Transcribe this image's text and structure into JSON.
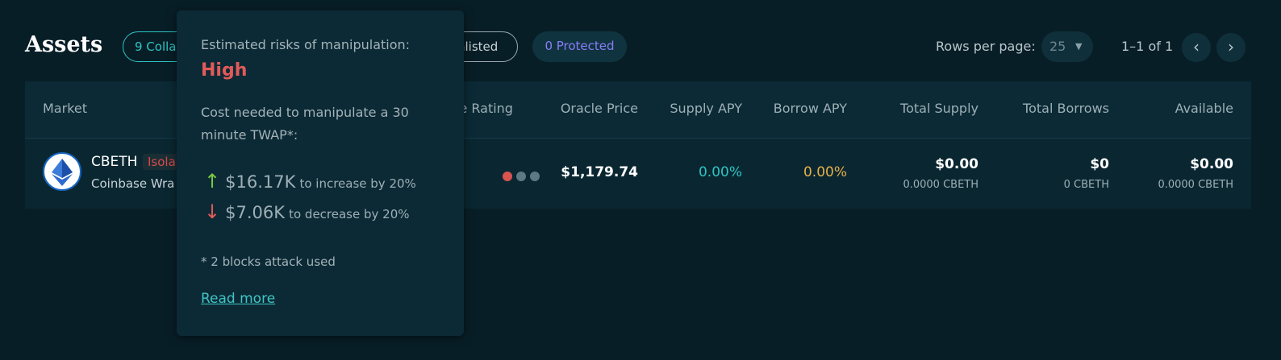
{
  "header": {
    "title": "Assets",
    "chips": {
      "collateral": "9 Collat",
      "unlisted": "nlisted",
      "protected": "0 Protected"
    },
    "rows_per_page_label": "Rows per page:",
    "rows_per_page_value": "25",
    "range": "1–1 of 1",
    "prev_icon": "‹",
    "next_icon": "›"
  },
  "table": {
    "columns": {
      "market": "Market",
      "oracle_rating": "le Rating",
      "oracle_price": "Oracle Price",
      "supply_apy": "Supply APY",
      "borrow_apy": "Borrow APY",
      "total_supply": "Total Supply",
      "total_borrows": "Total Borrows",
      "available": "Available"
    },
    "rows": [
      {
        "symbol": "CBETH",
        "badge": "Isola",
        "name": "Coinbase Wra",
        "rating_colors": [
          "#d9534f",
          "#5d7a84",
          "#5d7a84"
        ],
        "oracle_price": "$1,179.74",
        "supply_apy": "0.00%",
        "borrow_apy": "0.00%",
        "total_supply": "$0.00",
        "total_supply_sub": "0.0000 CBETH",
        "total_borrows": "$0",
        "total_borrows_sub": "0 CBETH",
        "available": "$0.00",
        "available_sub": "0.0000 CBETH"
      }
    ]
  },
  "tooltip": {
    "heading": "Estimated risks of manipulation:",
    "level": "High",
    "cost_text": "Cost needed to manipulate a 30 minute TWAP*:",
    "increase_amount": "$16.17K",
    "increase_text": "to increase by 20%",
    "decrease_amount": "$7.06K",
    "decrease_text": "to decrease by 20%",
    "footnote": "* 2 blocks attack used",
    "link": "Read more"
  },
  "colors": {
    "background": "#081e27",
    "accent_teal": "#2ec4c4",
    "protected_purple": "#8b7cf6",
    "supply_apy": "#2ec4c4",
    "borrow_apy": "#e8b04a",
    "risk_high": "#e25a5a",
    "arrow_up": "#7ac943",
    "arrow_down": "#e25a5a"
  },
  "icons": {
    "asset_logo": "ethereum-icon",
    "up": "arrow-up-icon",
    "down": "arrow-down-icon",
    "caret": "caret-down-icon"
  }
}
